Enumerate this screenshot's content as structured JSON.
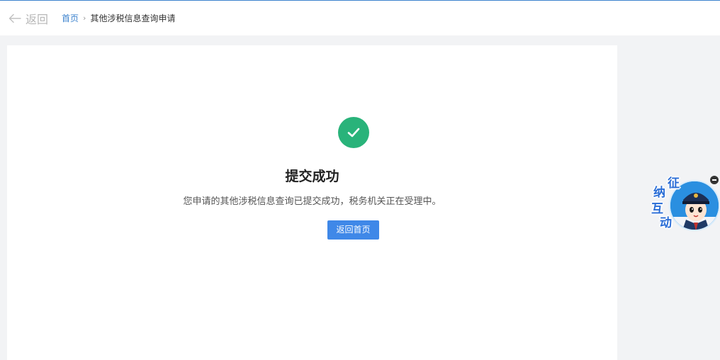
{
  "header": {
    "back_label": "返回",
    "breadcrumb": {
      "home": "首页",
      "separator": "›",
      "current": "其他涉税信息查询申请"
    }
  },
  "result": {
    "status": "success",
    "title": "提交成功",
    "description": "您申请的其他涉税信息查询已提交成功，税务机关正在受理中。",
    "button_label": "返回首页"
  },
  "assistant": {
    "chars": [
      "征",
      "纳",
      "互",
      "动"
    ]
  },
  "colors": {
    "accent": "#3d83ce",
    "button": "#3f88e8",
    "success": "#29b37a",
    "page_bg": "#f2f3f5"
  },
  "icons": {
    "back": "arrow-left-icon",
    "success": "check-circle-icon",
    "close": "minus-circle-icon"
  }
}
